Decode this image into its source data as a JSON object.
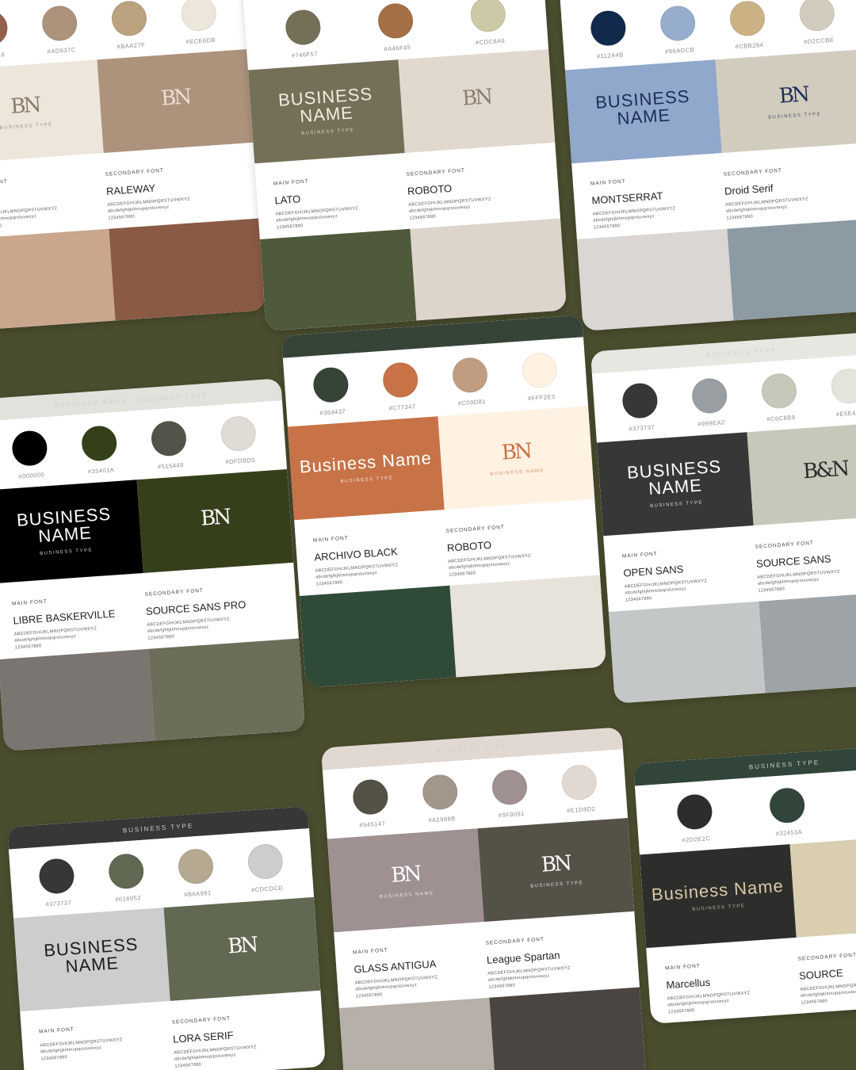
{
  "template": {
    "font_labels": {
      "main": "MAIN FONT",
      "secondary": "SECONDARY FONT"
    },
    "sample_upper": "ABCDEFGHIJKLMNOPQRSTUVWXYZ",
    "sample_lower": "abcdefghijklmnopqrstuvwxyz",
    "sample_digits": "1234567890"
  },
  "cards": [
    {
      "id": "terracotta-card",
      "header_color": "#956049",
      "header_text": "",
      "swatches": [
        {
          "color": "#956049",
          "hex": "#956049"
        },
        {
          "color": "#AD937C",
          "hex": "#AD937C"
        },
        {
          "color": "#BAA27F",
          "hex": "#BAA27F"
        },
        {
          "color": "#ECE6DB",
          "hex": "#ECE6DB"
        }
      ],
      "logo_left": {
        "bg": "#ECE6DB",
        "fg": "#8a7a6a",
        "title": "BN",
        "subtitle": "Business type"
      },
      "logo_right": {
        "bg": "#AD937C",
        "fg": "#e9dfd3",
        "title": "BN",
        "subtitle": ""
      },
      "fonts": {
        "main": "ONE",
        "secondary": "RALEWAY"
      },
      "photos": [
        "#c9a68c",
        "#8a5a44"
      ]
    },
    {
      "id": "olive-card",
      "header_color": "#ffffff",
      "header_text": "",
      "swatches": [
        {
          "color": "#746F57",
          "hex": "#746F57"
        },
        {
          "color": "#A46F45",
          "hex": "#A46F45"
        },
        {
          "color": "#CDC8A6",
          "hex": "#CDC8A6"
        }
      ],
      "logo_left": {
        "bg": "#746F57",
        "fg": "#f1ede4",
        "title": "BUSINESS NAME",
        "subtitle": "Business Type"
      },
      "logo_right": {
        "bg": "#E2D9CE",
        "fg": "#8b8070",
        "title": "BN",
        "subtitle": ""
      },
      "fonts": {
        "main": "LATO",
        "secondary": "ROBOTO"
      },
      "photos": [
        "#4e5a3b",
        "#ddd5cc"
      ]
    },
    {
      "id": "navy-card",
      "header_color": "#ffffff",
      "header_text": "",
      "swatches": [
        {
          "color": "#112A4B",
          "hex": "#112A4B"
        },
        {
          "color": "#96ADCB",
          "hex": "#96ADCB"
        },
        {
          "color": "#CBB284",
          "hex": "#CBB284"
        },
        {
          "color": "#D2CCBE",
          "hex": "#D2CCBE"
        }
      ],
      "logo_left": {
        "bg": "#8fa8cc",
        "fg": "#1d2e55",
        "title": "BUSINESS NAME",
        "subtitle": ""
      },
      "logo_right": {
        "bg": "#D2CCBE",
        "fg": "#1d2e55",
        "title": "BN",
        "subtitle": "Business type"
      },
      "fonts": {
        "main": "MONTSERRAT",
        "secondary": "Droid Serif"
      },
      "photos": [
        "#d9d6d3",
        "#8c9aa3"
      ]
    },
    {
      "id": "black-green-card",
      "header_color": "#E3E1DC",
      "header_text": "BUSINESS NAME · BUSINESS TYPE",
      "swatches": [
        {
          "color": "#000000",
          "hex": "#000000"
        },
        {
          "color": "#35401A",
          "hex": "#35401A"
        },
        {
          "color": "#515449",
          "hex": "#515449"
        },
        {
          "color": "#DFDBD5",
          "hex": "#DFDBD5"
        }
      ],
      "logo_left": {
        "bg": "#000000",
        "fg": "#ffffff",
        "title": "BUSINESS NAME",
        "subtitle": "Business type"
      },
      "logo_right": {
        "bg": "#35401A",
        "fg": "#ffffff",
        "title": "BN",
        "subtitle": ""
      },
      "fonts": {
        "main": "LIBRE BASKERVILLE",
        "secondary": "SOURCE SANS PRO"
      },
      "photos": [
        "#7a7570",
        "#6d6e5a"
      ]
    },
    {
      "id": "orange-card",
      "header_color": "#364437",
      "header_text": "",
      "swatches": [
        {
          "color": "#364437",
          "hex": "#364437"
        },
        {
          "color": "#C77347",
          "hex": "#C77347"
        },
        {
          "color": "#C09D81",
          "hex": "#C09D81"
        },
        {
          "color": "#FFF2E3",
          "hex": "#FFF2E3"
        }
      ],
      "logo_left": {
        "bg": "#C77347",
        "fg": "#ffffff",
        "title": "Business Name",
        "subtitle": "Business type"
      },
      "logo_right": {
        "bg": "#FFF2E3",
        "fg": "#C77347",
        "title": "BN",
        "subtitle": "Business name"
      },
      "fonts": {
        "main": "ARCHIVO BLACK",
        "secondary": "ROBOTO"
      },
      "photos": [
        "#2f4a36",
        "#e7e2da"
      ]
    },
    {
      "id": "charcoal-card",
      "header_color": "#E8E6E0",
      "header_text": "BUSINESS TYPE",
      "swatches": [
        {
          "color": "#373737",
          "hex": "#373737"
        },
        {
          "color": "#999EA2",
          "hex": "#999EA2"
        },
        {
          "color": "#C6C8B9",
          "hex": "#C6C8B9"
        },
        {
          "color": "#E5E4DC",
          "hex": "#E5E4DC"
        }
      ],
      "logo_left": {
        "bg": "#373737",
        "fg": "#ffffff",
        "title": "BUSINESS NAME",
        "subtitle": "Business type"
      },
      "logo_right": {
        "bg": "#C6C8B9",
        "fg": "#2b2b2b",
        "title": "B&N",
        "subtitle": ""
      },
      "fonts": {
        "main": "OPEN SANS",
        "secondary": "SOURCE SANS"
      },
      "photos": [
        "#c4c7c8",
        "#9ea3a7"
      ]
    },
    {
      "id": "sage-card",
      "header_color": "#373737",
      "header_text": "Business Type",
      "swatches": [
        {
          "color": "#373737",
          "hex": "#373737"
        },
        {
          "color": "#616952",
          "hex": "#616952"
        },
        {
          "color": "#B6A991",
          "hex": "#B6A991"
        },
        {
          "color": "#CDCDCD",
          "hex": "#CDCDCD"
        }
      ],
      "logo_left": {
        "bg": "#CDCDCD",
        "fg": "#1c1c1c",
        "title": "BUSINESS NAME",
        "subtitle": ""
      },
      "logo_right": {
        "bg": "#616952",
        "fg": "#ffffff",
        "title": "BN",
        "subtitle": ""
      },
      "fonts": {
        "main": "",
        "secondary": "LORA SERIF"
      },
      "photos": []
    },
    {
      "id": "mauve-card",
      "header_color": "#E1D8D2",
      "header_text": "Business Type",
      "swatches": [
        {
          "color": "#545147",
          "hex": "#545147"
        },
        {
          "color": "#A1988B",
          "hex": "#A1988B"
        },
        {
          "color": "#9F9091",
          "hex": "#9F9091"
        },
        {
          "color": "#E1D8D2",
          "hex": "#E1D8D2"
        }
      ],
      "logo_left": {
        "bg": "#9F9091",
        "fg": "#ffffff",
        "title": "BN",
        "subtitle": "Business Name"
      },
      "logo_right": {
        "bg": "#545147",
        "fg": "#ffffff",
        "title": "BN",
        "subtitle": "Business Type"
      },
      "fonts": {
        "main": "GLASS ANTIGUA",
        "secondary": "League Spartan"
      },
      "photos": [
        "#b7b0a8",
        "#4a4541"
      ]
    },
    {
      "id": "brown-card",
      "header_color": "#32453A",
      "header_text": "BUSINESS TYPE",
      "swatches": [
        {
          "color": "#2D2E2C",
          "hex": "#2D2E2C"
        },
        {
          "color": "#32453A",
          "hex": "#32453A"
        },
        {
          "color": "#956834",
          "hex": "#956834"
        }
      ],
      "logo_left": {
        "bg": "#2D2E2C",
        "fg": "#d9c9a7",
        "title": "Business Name",
        "subtitle": "Business type"
      },
      "logo_right": {
        "bg": "#D9CFB0",
        "fg": "#2D2E2C",
        "title": "",
        "subtitle": ""
      },
      "fonts": {
        "main": "Marcellus",
        "secondary": "SOURCE"
      },
      "photos": []
    }
  ]
}
